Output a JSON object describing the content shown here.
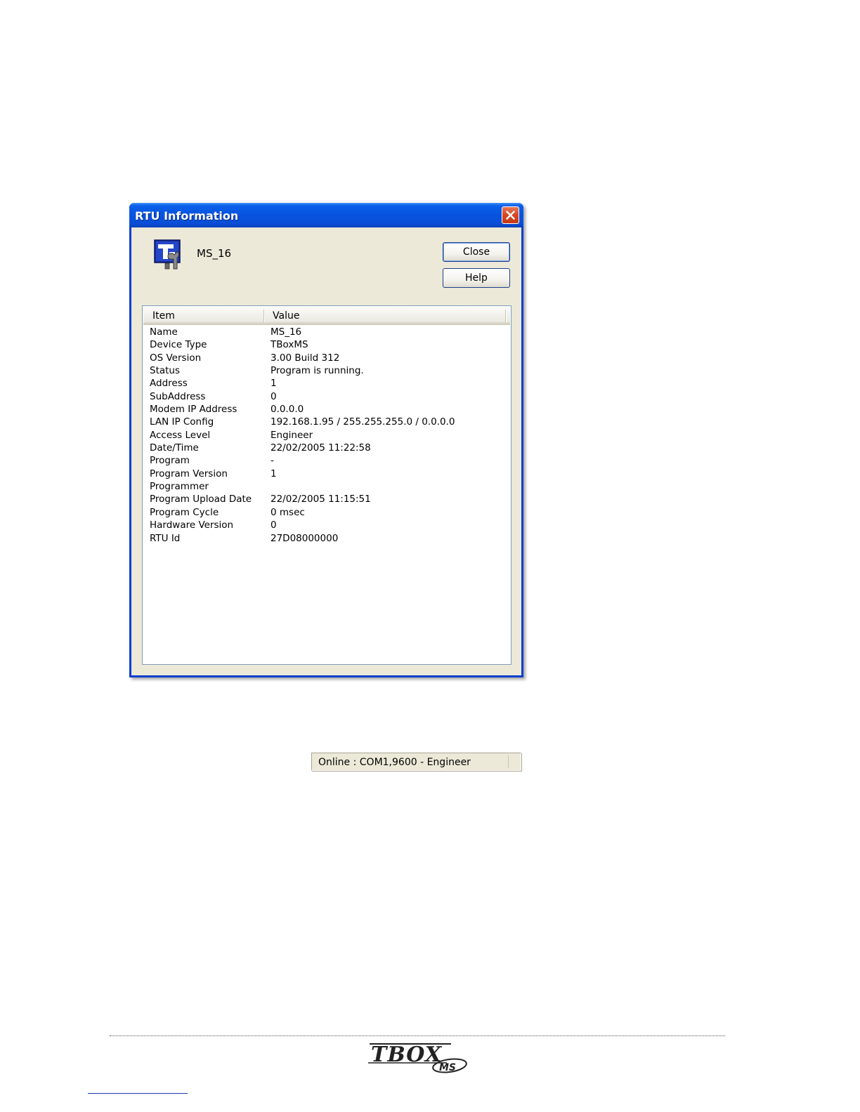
{
  "dialog": {
    "title": "RTU Information",
    "device_name": "MS_16",
    "buttons": {
      "close": "Close",
      "help": "Help"
    },
    "columns": {
      "item": "Item",
      "value": "Value"
    },
    "rows": [
      {
        "item": "Name",
        "value": "MS_16"
      },
      {
        "item": "Device Type",
        "value": "TBoxMS"
      },
      {
        "item": "OS Version",
        "value": "3.00 Build 312"
      },
      {
        "item": "Status",
        "value": "Program is running."
      },
      {
        "item": "Address",
        "value": "1"
      },
      {
        "item": "SubAddress",
        "value": "0"
      },
      {
        "item": "Modem IP Address",
        "value": "0.0.0.0"
      },
      {
        "item": "LAN IP Config",
        "value": "192.168.1.95 / 255.255.255.0 / 0.0.0.0"
      },
      {
        "item": "Access Level",
        "value": "Engineer"
      },
      {
        "item": "Date/Time",
        "value": "22/02/2005 11:22:58"
      },
      {
        "item": "Program",
        "value": "-"
      },
      {
        "item": "Program Version",
        "value": "1"
      },
      {
        "item": "Programmer",
        "value": ""
      },
      {
        "item": "Program Upload Date",
        "value": "22/02/2005 11:15:51"
      },
      {
        "item": "Program Cycle",
        "value": "0 msec"
      },
      {
        "item": "Hardware Version",
        "value": "0"
      },
      {
        "item": "RTU Id",
        "value": "27D08000000"
      }
    ]
  },
  "statusbar": {
    "text": "Online : COM1,9600 - Engineer"
  },
  "footer": {
    "logo_text": "TBOX",
    "logo_sub": "MS"
  },
  "icons": {
    "app": "tbox-tool-icon",
    "close": "close-icon",
    "logo": "tbox-ms-logo"
  },
  "colors": {
    "titlebar": "#0753e0",
    "window_bg": "#ece9d8",
    "close_button": "#d9461f"
  }
}
